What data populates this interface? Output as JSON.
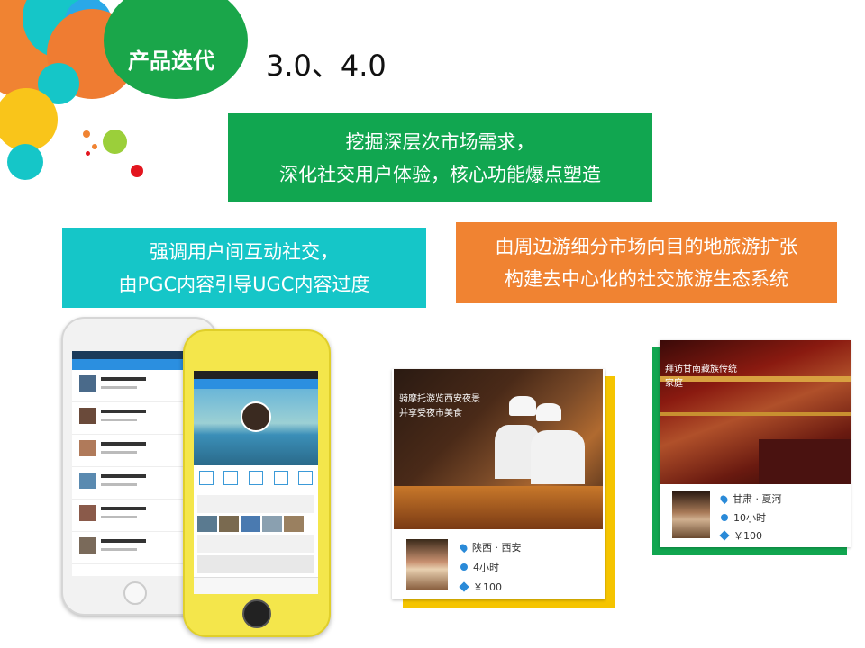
{
  "header": {
    "badge": "产品迭代",
    "version": "3.0、4.0"
  },
  "boxes": {
    "green": [
      "挖掘深层次市场需求，",
      "深化社交用户体验，核心功能爆点塑造"
    ],
    "teal": [
      "强调用户间互动社交，",
      "由PGC内容引导UGC内容过度"
    ],
    "orange": [
      "由周边游细分市场向目的地旅游扩张",
      "构建去中心化的社交旅游生态系统"
    ]
  },
  "cards": [
    {
      "caption": [
        "骑摩托游览西安夜景",
        "并享受夜市美食"
      ],
      "location": "陕西 · 西安",
      "duration": "4小时",
      "price": "￥100"
    },
    {
      "caption": [
        "拜访甘南藏族传统",
        "家庭"
      ],
      "location": "甘肃 · 夏河",
      "duration": "10小时",
      "price": "￥100"
    }
  ],
  "colors": {
    "green": "#11a650",
    "teal": "#15c6c8",
    "orange": "#f08332",
    "yellow": "#f5c400"
  }
}
